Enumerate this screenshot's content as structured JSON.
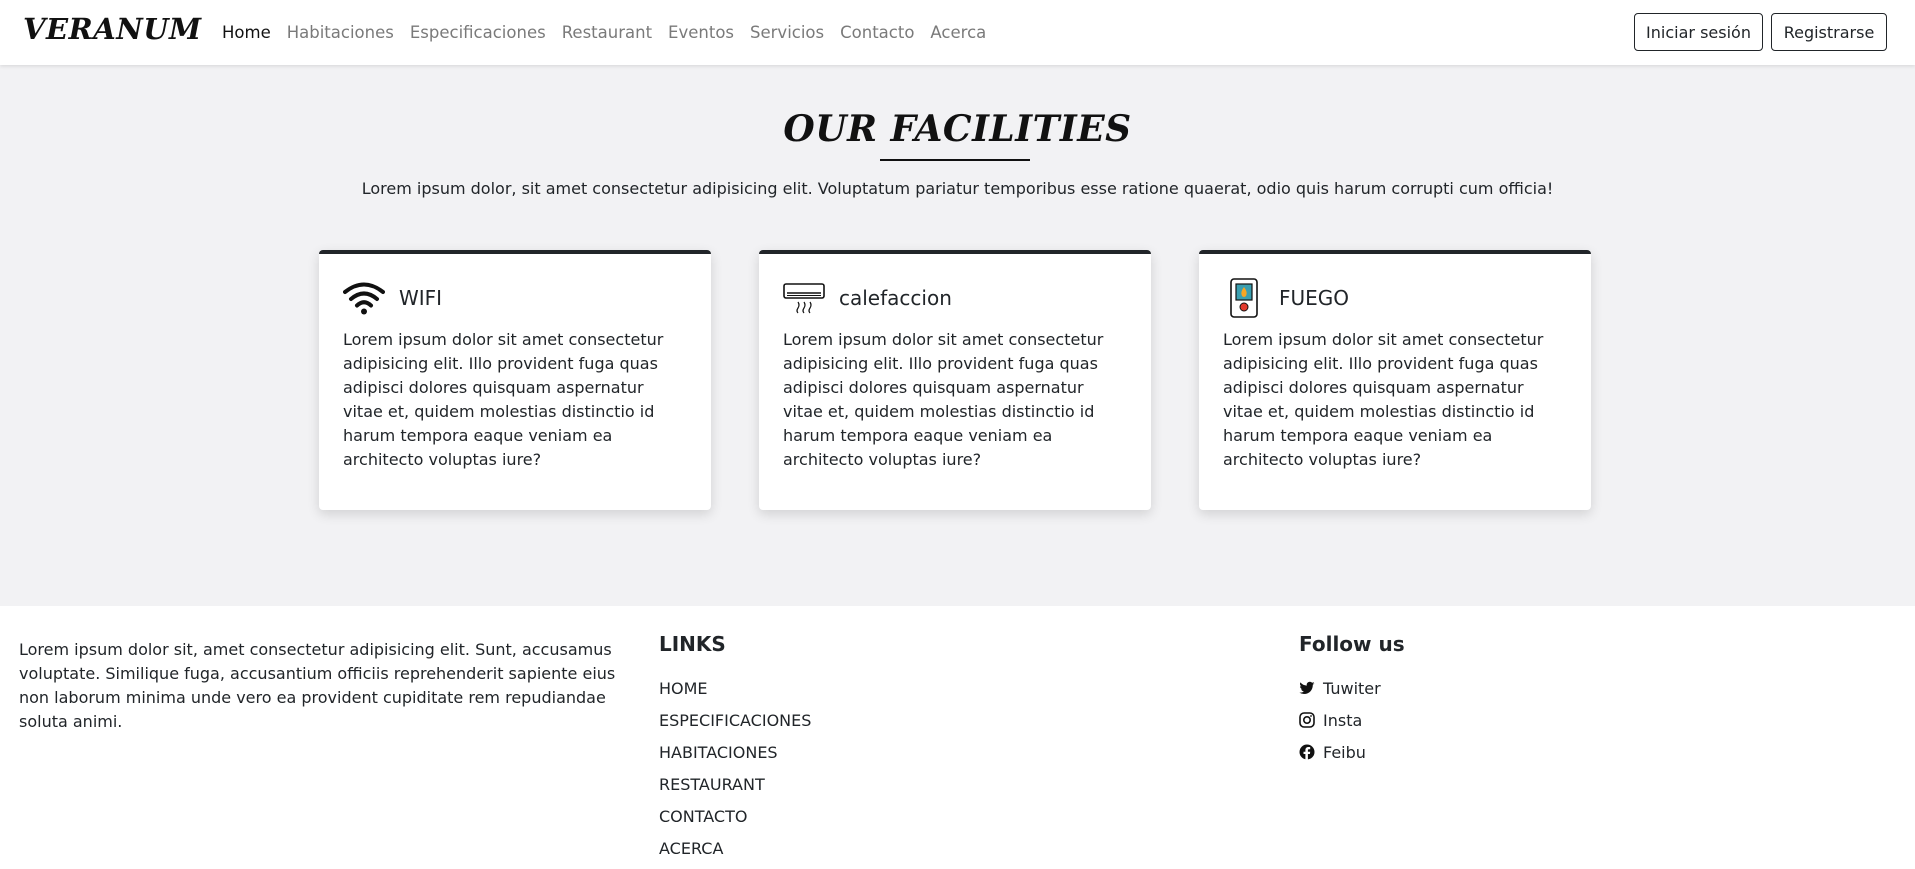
{
  "navbar": {
    "brand": "VERANUM",
    "links": [
      "Home",
      "Habitaciones",
      "Especificaciones",
      "Restaurant",
      "Eventos",
      "Servicios",
      "Contacto",
      "Acerca"
    ],
    "login_label": "Iniciar sesión",
    "register_label": "Registrarse"
  },
  "facilities": {
    "title": "OUR FACILITIES",
    "intro": "Lorem ipsum dolor, sit amet consectetur adipisicing elit. Voluptatum pariatur temporibus esse ratione quaerat, odio quis harum corrupti cum officia!",
    "cards": [
      {
        "title": "WIFI",
        "icon": "wifi-icon",
        "text": "Lorem ipsum dolor sit amet consectetur adipisicing elit. Illo provident fuga quas adipisci dolores quisquam aspernatur vitae et, quidem molestias distinctio id harum tempora eaque veniam ea architecto voluptas iure?"
      },
      {
        "title": "calefaccion",
        "icon": "air-conditioner-icon",
        "text": "Lorem ipsum dolor sit amet consectetur adipisicing elit. Illo provident fuga quas adipisci dolores quisquam aspernatur vitae et, quidem molestias distinctio id harum tempora eaque veniam ea architecto voluptas iure?"
      },
      {
        "title": "FUEGO",
        "icon": "fire-alarm-icon",
        "text": "Lorem ipsum dolor sit amet consectetur adipisicing elit. Illo provident fuga quas adipisci dolores quisquam aspernatur vitae et, quidem molestias distinctio id harum tempora eaque veniam ea architecto voluptas iure?"
      }
    ]
  },
  "footer": {
    "about": "Lorem ipsum dolor sit, amet consectetur adipisicing elit. Sunt, accusamus voluptate. Similique fuga, accusantium officiis reprehenderit sapiente eius non laborum minima unde vero ea provident cupiditate rem repudiandae soluta animi.",
    "links_title": "LINKS",
    "links": [
      "HOME",
      "ESPECIFICACIONES",
      "HABITACIONES",
      "RESTAURANT",
      "CONTACTO",
      "ACERCA"
    ],
    "follow_title": "Follow us",
    "social": [
      {
        "label": "Tuwiter",
        "icon": "twitter-icon"
      },
      {
        "label": "Insta",
        "icon": "instagram-icon"
      },
      {
        "label": "Feibu",
        "icon": "facebook-icon"
      }
    ]
  }
}
